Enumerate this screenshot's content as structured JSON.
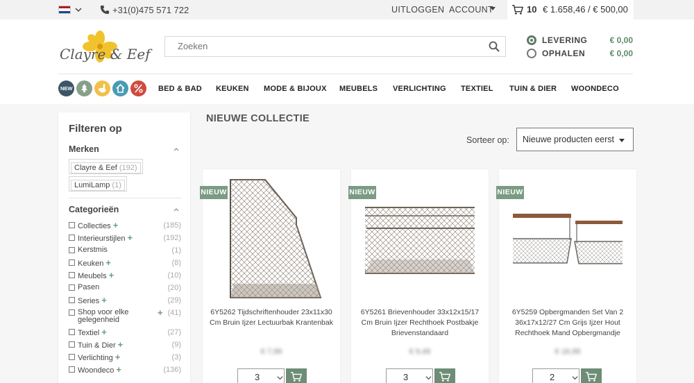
{
  "topbar": {
    "flag_colors": [
      "#ae1c28",
      "#ffffff",
      "#21468b"
    ],
    "phone": "+31(0)475 571 722",
    "logout": "UITLOGGEN",
    "account": "ACCOUNT",
    "cart_count": "10",
    "cart_total": "€ 1.658,46 / € 500,00"
  },
  "header": {
    "logo_text": "Clayre & Eef",
    "search_placeholder": "Zoeken",
    "delivery": [
      {
        "label": "LEVERING",
        "price": "€ 0,00",
        "selected": true
      },
      {
        "label": "OPHALEN",
        "price": "€ 0,00",
        "selected": false
      }
    ]
  },
  "nav": {
    "circle_icons": [
      {
        "name": "new-icon",
        "label": "NEW",
        "color": "#3d5566"
      },
      {
        "name": "tree-icon",
        "color": "#86a08c"
      },
      {
        "name": "rabbit-icon",
        "color": "#f2c04a"
      },
      {
        "name": "house-icon",
        "color": "#4a9bb3"
      },
      {
        "name": "percent-icon",
        "color": "#cf4b3e"
      }
    ],
    "links": [
      "BED & BAD",
      "KEUKEN",
      "MODE & BIJOUX",
      "MEUBELS",
      "VERLICHTING",
      "TEXTIEL",
      "TUIN & DIER",
      "WOONDECO"
    ]
  },
  "sidebar": {
    "title": "Filteren op",
    "brands_heading": "Merken",
    "brands": [
      {
        "name": "Clayre & Eef",
        "count": "(192)"
      },
      {
        "name": "LumiLamp",
        "count": "(1)"
      }
    ],
    "categories_heading": "Categorieën",
    "categories": [
      {
        "name": "Collecties",
        "count": "(185)",
        "expandable": true
      },
      {
        "name": "Interieurstijlen",
        "count": "(192)",
        "expandable": true
      },
      {
        "name": "Kerstmis",
        "count": "(1)",
        "expandable": false
      },
      {
        "name": "Keuken",
        "count": "(8)",
        "expandable": true
      },
      {
        "name": "Meubels",
        "count": "(10)",
        "expandable": true
      },
      {
        "name": "Pasen",
        "count": "(20)",
        "expandable": false
      },
      {
        "name": "Series",
        "count": "(29)",
        "expandable": true
      },
      {
        "name": "Shop voor elke gelegenheid",
        "count": "(41)",
        "expandable": true
      },
      {
        "name": "Textiel",
        "count": "(27)",
        "expandable": true
      },
      {
        "name": "Tuin & Dier",
        "count": "(9)",
        "expandable": true
      },
      {
        "name": "Verlichting",
        "count": "(3)",
        "expandable": true
      },
      {
        "name": "Woondeco",
        "count": "(136)",
        "expandable": true
      }
    ]
  },
  "main": {
    "title": "NIEUWE COLLECTIE",
    "sort_label": "Sorteer op:",
    "sort_value": "Nieuwe producten eerst",
    "products": [
      {
        "badge": "NIEUW",
        "name": "6Y5262 Tijdschriftenhouder 23x11x30 Cm Bruin Ijzer Lectuurbak Krantenbak",
        "price": "€ 7,99",
        "qty": "3"
      },
      {
        "badge": "NIEUW",
        "name": "6Y5261 Brievenhouder 33x12x15/17 Cm Bruin Ijzer Rechthoek Postbakje Brievenstandaard",
        "price": "€ 9,49",
        "qty": "3"
      },
      {
        "badge": "NIEUW",
        "name": "6Y5259 Opbergmanden Set Van 2 36x17x12/27 Cm Grijs Ijzer Hout Rechthoek Mand Opbergmandje",
        "price": "€ 16,99",
        "qty": "2"
      }
    ]
  }
}
